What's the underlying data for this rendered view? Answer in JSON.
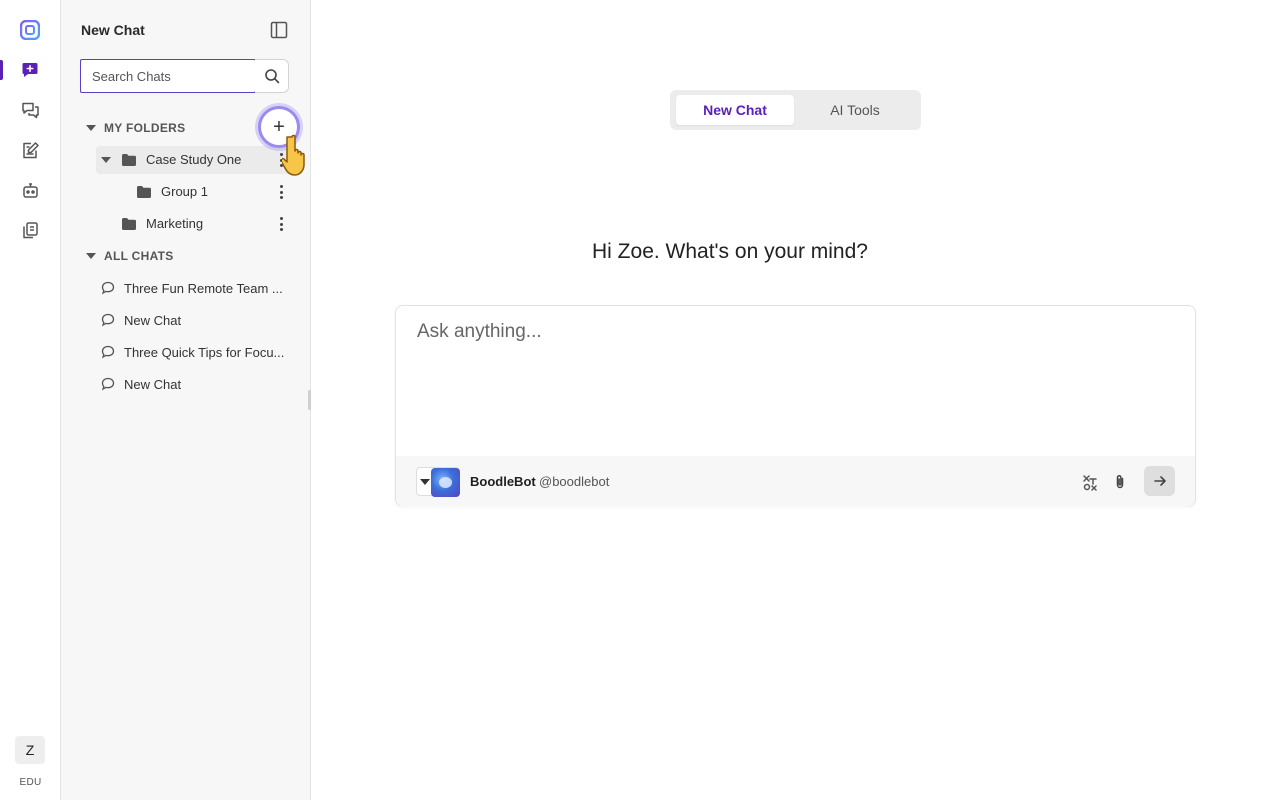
{
  "rail": {
    "items": [
      {
        "name": "new-chat",
        "icon": "chat-plus-icon",
        "active": true
      },
      {
        "name": "chats",
        "icon": "chats-icon"
      },
      {
        "name": "prompts",
        "icon": "edit-note-icon"
      },
      {
        "name": "bots",
        "icon": "robot-icon"
      },
      {
        "name": "library",
        "icon": "copy-icon"
      }
    ],
    "avatar_initial": "Z",
    "plan_label": "EDU",
    "accent": "#5b21b6"
  },
  "sidebar": {
    "title": "New Chat",
    "search": {
      "placeholder": "Search Chats",
      "value": ""
    },
    "my_folders": {
      "label": "MY FOLDERS",
      "add_label": "+",
      "folders": [
        {
          "label": "Case Study One",
          "expanded": true,
          "selected": true
        },
        {
          "label": "Group 1",
          "nested": true
        },
        {
          "label": "Marketing"
        }
      ]
    },
    "all_chats": {
      "label": "ALL CHATS",
      "items": [
        {
          "label": "Three Fun Remote Team ..."
        },
        {
          "label": "New Chat"
        },
        {
          "label": "Three Quick Tips for Focu..."
        },
        {
          "label": "New Chat"
        }
      ]
    }
  },
  "main": {
    "tabs": [
      {
        "label": "New Chat",
        "active": true
      },
      {
        "label": "AI Tools",
        "active": false
      }
    ],
    "greeting": "Hi Zoe. What's on your mind?",
    "composer": {
      "placeholder": "Ask anything...",
      "bot_name": "BoodleBot",
      "bot_handle": "@boodlebot",
      "actions": [
        "clear-format-icon",
        "paperclip-icon",
        "send-arrow-icon"
      ]
    }
  }
}
